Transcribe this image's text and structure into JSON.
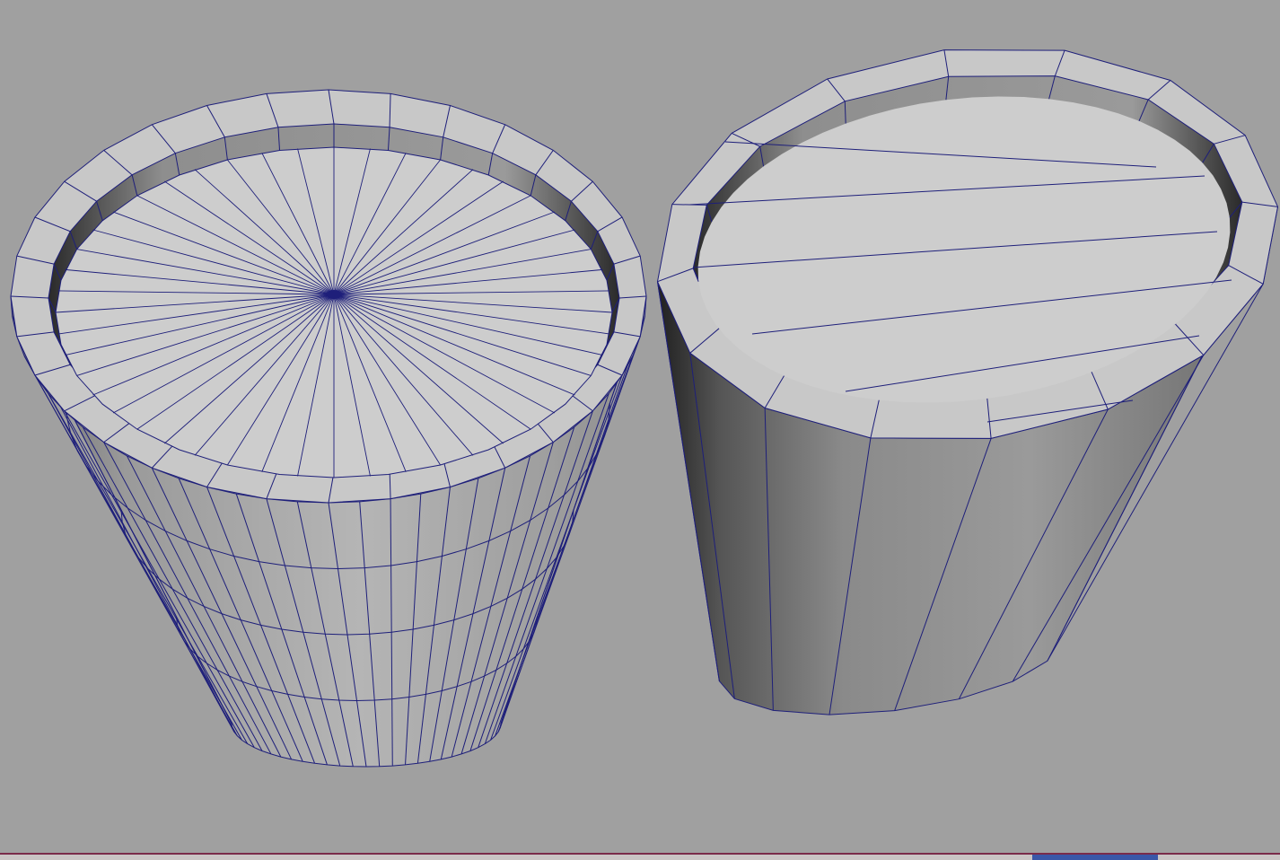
{
  "viewport": {
    "background": "#a0a0a0",
    "wire_color": "#1e1f7a"
  },
  "objects": [
    {
      "kind": "polygon cylinder",
      "style": "radial cap",
      "sides": 32,
      "height_subdivisions": 4
    },
    {
      "kind": "polygon cylinder",
      "style": "planked cap",
      "sides": 16,
      "height_subdivisions": 1
    }
  ]
}
